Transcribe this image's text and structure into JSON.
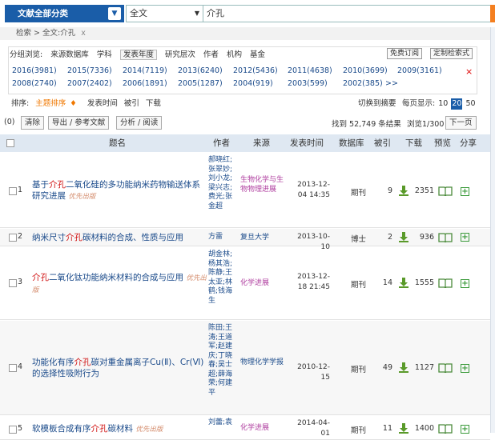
{
  "search": {
    "scope_label": "文献全部分类",
    "field": "全文",
    "query": "介孔"
  },
  "breadcrumb": {
    "text": "检索 > 全文:介孔",
    "close": "x"
  },
  "filters": {
    "group_label": "分组浏览:",
    "tabs": [
      "来源数据库",
      "学科",
      "发表年度",
      "研究层次",
      "作者",
      "机构",
      "基金"
    ],
    "subscribe_label": "免费订阅",
    "custom_search_label": "定制检索式",
    "years": [
      "2016(3981)",
      "2015(7336)",
      "2014(7119)",
      "2013(6240)",
      "2012(5436)",
      "2011(4638)",
      "2010(3699)",
      "2009(3161)",
      "2008(2740)",
      "2007(2402)",
      "2006(1891)",
      "2005(1287)",
      "2004(919)",
      "2003(599)",
      "2002(385)",
      ">>"
    ],
    "close": "×"
  },
  "sort": {
    "label": "排序:",
    "options": [
      "主题排序",
      "发表时间",
      "被引",
      "下载"
    ],
    "switch_label": "切换到摘要",
    "per_page_label": "每页显示:",
    "per_page": [
      "10",
      "20",
      "50"
    ]
  },
  "toolbar": {
    "count": "(0)",
    "clear": "清除",
    "export": "导出 / 参考文献",
    "analyze": "分析 / 阅读",
    "found": "找到 52,749 条结果",
    "browse": "浏览1/300",
    "next": "下一页"
  },
  "table": {
    "headers": [
      "题名",
      "作者",
      "来源",
      "发表时间",
      "数据库",
      "被引",
      "下载",
      "预览",
      "分享"
    ],
    "rows": [
      {
        "num": "1",
        "title_a": "基于",
        "title_hl": "介孔",
        "title_b": "二氧化硅的多功能纳米药物输送体系研究进展",
        "tag": "优先出版",
        "authors": "郝晓红;张翠妙;刘小龙;梁兴志;费光;张金超",
        "source": "生物化学与生物物理进展",
        "date": "2013-12-04 14:35",
        "db": "期刊",
        "cite": "9",
        "downloads": "2351"
      },
      {
        "num": "2",
        "title_a": "纳米尺寸",
        "title_hl": "介孔",
        "title_b": "碳材料的合成、性质与应用",
        "tag": "",
        "authors": "方雷",
        "source": "复旦大学",
        "date": "2013-10-10",
        "db": "博士",
        "cite": "2",
        "downloads": "936"
      },
      {
        "num": "3",
        "title_a": "",
        "title_hl": "介孔",
        "title_b": "二氧化钛功能纳米材料的合成与应用",
        "tag": "优先出版",
        "authors": "胡金林;杨其浩;陈静;王太亚;林鹤;钱海生",
        "source": "化学进展",
        "date": "2013-12-18 21:45",
        "db": "期刊",
        "cite": "14",
        "downloads": "1555"
      },
      {
        "num": "4",
        "title_a": "功能化有序",
        "title_hl": "介孔",
        "title_b": "碳对重金属离子Cu(Ⅱ)、Cr(Ⅵ)的选择性吸附行为",
        "tag": "",
        "authors": "陈田;王涛;王道军;赵建庆;丁晓春;吴士超;薛海荣;何建平",
        "source": "物理化学学报",
        "date": "2010-12-15",
        "db": "期刊",
        "cite": "49",
        "downloads": "1127"
      },
      {
        "num": "5",
        "title_a": "软模板合成有序",
        "title_hl": "介孔",
        "title_b": "碳材料",
        "tag": "优先出版",
        "authors": "刘蕾;袁",
        "source": "化学进展",
        "date": "2014-04-01",
        "db": "期刊",
        "cite": "11",
        "downloads": "1400"
      }
    ]
  },
  "colors": {
    "brand_blue": "#1a5da8",
    "accent_orange": "#f47f20",
    "highlight_red": "#d01010",
    "icon_green": "#3a9a3a"
  }
}
